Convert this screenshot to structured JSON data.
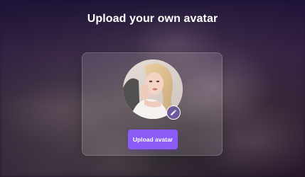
{
  "header": {
    "title": "Upload your own avatar"
  },
  "upload_card": {
    "button_label": "Upload avatar",
    "edit_icon": "pencil-icon"
  },
  "colors": {
    "accent": "#8b5cf6",
    "edit_badge": "#6d5a9b",
    "title_text": "#ffffff"
  }
}
